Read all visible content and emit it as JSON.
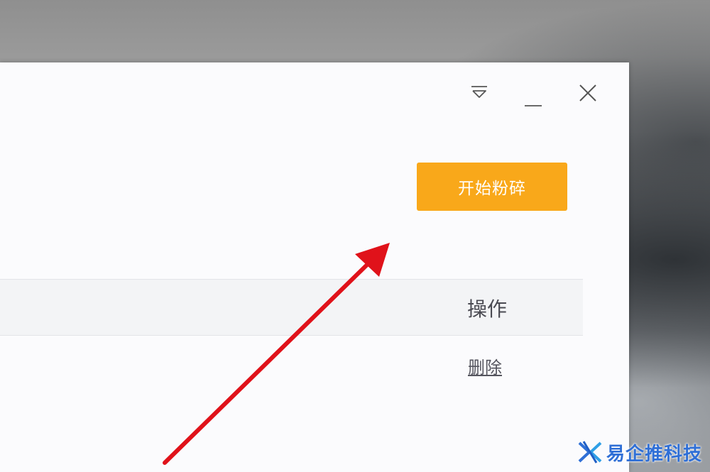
{
  "window": {
    "start_button_label": "开始粉碎",
    "table": {
      "columns": [
        "操作"
      ],
      "rows": [
        {
          "action": "删除"
        }
      ]
    }
  },
  "icons": {
    "menu": "dropdown-triangle-icon",
    "minimize": "minimize-icon",
    "close": "close-icon"
  },
  "colors": {
    "accent": "#f9a81a",
    "annotation_arrow": "#e0121a",
    "watermark": "#2f6fd6"
  },
  "watermark": {
    "text": "易企推科技"
  }
}
